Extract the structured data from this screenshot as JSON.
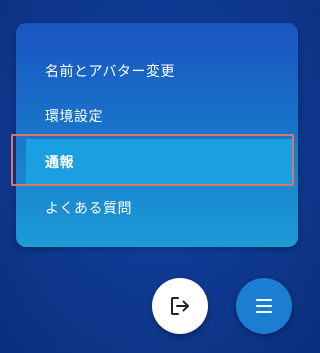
{
  "menu": {
    "items": [
      {
        "label": "名前とアバター変更"
      },
      {
        "label": "環境設定"
      },
      {
        "label": "通報",
        "selected": true
      },
      {
        "label": "よくある質問"
      }
    ]
  },
  "buttons": {
    "logout_icon": "logout-icon",
    "menu_icon": "hamburger-menu-icon"
  },
  "colors": {
    "background": "#0f3a92",
    "panel_top": "#1a55c0",
    "panel_bottom": "#1c9bd6",
    "selected_item": "#1a9fe2",
    "focus_outline": "#e0735f",
    "menu_fab": "#1c7ed2",
    "logout_fab": "#ffffff"
  }
}
